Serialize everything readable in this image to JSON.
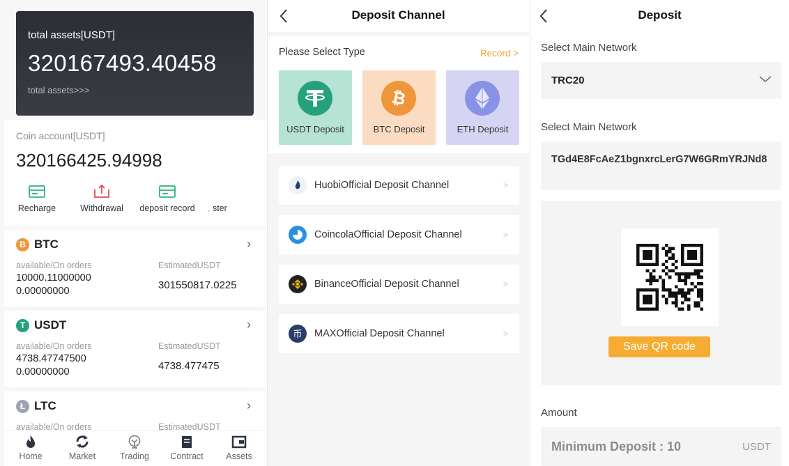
{
  "wallet": {
    "total_label": "total assets[USDT]",
    "total_value": "320167493.40458",
    "total_link": "total assets>>>",
    "coin_label": "Coin account[USDT]",
    "coin_value": "320166425.94998",
    "actions": [
      {
        "label": "Recharge",
        "icon": "recharge-card-icon",
        "color": "#2fb37b"
      },
      {
        "label": "Withdrawal",
        "icon": "withdrawal-upload-icon",
        "color": "#e04a4a"
      },
      {
        "label": "deposit record",
        "icon": "record-card-icon",
        "color": "#2fb37b"
      },
      {
        "label": "ster",
        "icon": "transfer-icon",
        "color": "#999999"
      }
    ],
    "coins": [
      {
        "symbol": "BTC",
        "badge": "B",
        "badge_color": "#f0953a",
        "sub_left": "available/On orders",
        "sub_right": "EstimatedUSDT",
        "available": "10000.11000000",
        "on_orders": "0.00000000",
        "estimated": "301550817.0225"
      },
      {
        "symbol": "USDT",
        "badge": "T",
        "badge_color": "#27a17c",
        "sub_left": "available/On orders",
        "sub_right": "EstimatedUSDT",
        "available": "4738.47747500",
        "on_orders": "0.00000000",
        "estimated": "4738.477475"
      },
      {
        "symbol": "LTC",
        "badge": "Ł",
        "badge_color": "#a0a3b0",
        "sub_left": "available/On orders",
        "sub_right": "EstimatedUSDT",
        "available": "",
        "on_orders": "",
        "estimated": ""
      }
    ],
    "tabs": [
      {
        "label": "Home",
        "icon": "flame-icon"
      },
      {
        "label": "Market",
        "icon": "refresh-icon"
      },
      {
        "label": "Trading",
        "icon": "trading-icon"
      },
      {
        "label": "Contract",
        "icon": "contract-icon"
      },
      {
        "label": "Assets",
        "icon": "wallet-icon"
      }
    ]
  },
  "channel": {
    "title": "Deposit Channel",
    "select_type_label": "Please Select Type",
    "record_link": "Record >",
    "types": [
      {
        "label": "USDT Deposit",
        "bg": "#b7e3d5",
        "circle": "#27a17c",
        "glyph": "T"
      },
      {
        "label": "BTC Deposit",
        "bg": "#fbdcc2",
        "circle": "#f0953a",
        "glyph": "₿"
      },
      {
        "label": "ETH Deposit",
        "bg": "#d5d5f3",
        "circle": "#8a92e6",
        "glyph": "◆"
      }
    ],
    "channels": [
      {
        "label": "HuobiOfficial Deposit Channel",
        "icon": "huobi-logo-icon",
        "color": "#ffffff"
      },
      {
        "label": "CoincolaOfficial Deposit Channel",
        "icon": "coincola-logo-icon",
        "color": "#2a8fe0"
      },
      {
        "label": "BinanceOfficial Deposit Channel",
        "icon": "binance-logo-icon",
        "color": "#222222"
      },
      {
        "label": "MAXOfficial Deposit Channel",
        "icon": "max-logo-icon",
        "color": "#2b3d6b"
      }
    ],
    "chevron": ">"
  },
  "deposit": {
    "title": "Deposit",
    "network_label": "Select Main Network",
    "network_value": "TRC20",
    "address_label": "Select Main Network",
    "address_value": "TGd4E8FcAeZ1bgnxrcLerG7W6GRmYRJNd8",
    "save_qr_label": "Save QR code",
    "amount_label": "Amount",
    "amount_placeholder": "Minimum Deposit : 10",
    "amount_unit": "USDT"
  }
}
